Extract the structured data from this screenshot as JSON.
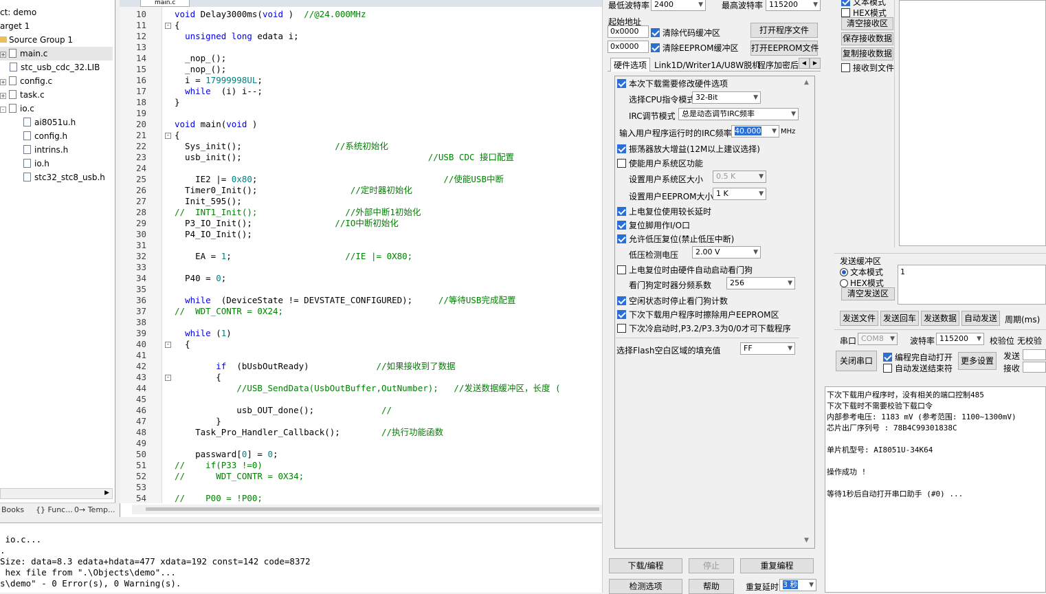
{
  "project": {
    "root": "ct: demo",
    "target": "arget 1",
    "group": "Source Group 1",
    "files": [
      "main.c",
      "stc_usb_cdc_32.LIB",
      "config.c",
      "task.c",
      "io.c"
    ],
    "headers": [
      "ai8051u.h",
      "config.h",
      "intrins.h",
      "io.h",
      "stc32_stc8_usb.h"
    ],
    "tabs": [
      "Books",
      "{} Func...",
      "0→ Temp..."
    ]
  },
  "editor": {
    "tab": "main.c",
    "lines": [
      {
        "n": "10",
        "fold": "",
        "code": [
          [
            "kw",
            "void"
          ],
          [
            "",
            "Delay3000ms("
          ],
          [
            "kw",
            "void"
          ],
          [
            "",
            ")  "
          ],
          [
            "cm",
            "//@24.000MHz"
          ]
        ]
      },
      {
        "n": "11",
        "fold": "-",
        "code": [
          [
            "",
            "{"
          ]
        ]
      },
      {
        "n": "12",
        "fold": "",
        "code": [
          [
            "",
            "  "
          ],
          [
            "kw",
            "unsigned long"
          ],
          [
            "",
            "edata i;"
          ]
        ]
      },
      {
        "n": "13",
        "fold": "",
        "code": []
      },
      {
        "n": "14",
        "fold": "",
        "code": [
          [
            "",
            "  _nop_();"
          ]
        ]
      },
      {
        "n": "15",
        "fold": "",
        "code": [
          [
            "",
            "  _nop_();"
          ]
        ]
      },
      {
        "n": "16",
        "fold": "",
        "code": [
          [
            "",
            "  i = "
          ],
          [
            "nm",
            "17999998UL"
          ],
          [
            "",
            ";"
          ]
        ]
      },
      {
        "n": "17",
        "fold": "",
        "code": [
          [
            "",
            "  "
          ],
          [
            "kw",
            "while"
          ],
          [
            "",
            "",
            " (i) i--;"
          ]
        ]
      },
      {
        "n": "18",
        "fold": "",
        "code": [
          [
            "",
            "}"
          ]
        ]
      },
      {
        "n": "19",
        "fold": "",
        "code": []
      },
      {
        "n": "20",
        "fold": "",
        "code": [
          [
            "kw",
            "void"
          ],
          [
            "",
            "main("
          ],
          [
            "kw",
            "void"
          ],
          [
            "",
            ")"
          ]
        ]
      },
      {
        "n": "21",
        "fold": "-",
        "code": [
          [
            "",
            "{"
          ]
        ]
      },
      {
        "n": "22",
        "fold": "",
        "code": [
          [
            "",
            "  Sys_init();                  "
          ],
          [
            "cm",
            "//系统初始化"
          ]
        ]
      },
      {
        "n": "23",
        "fold": "",
        "code": [
          [
            "",
            "  usb_init();                                    "
          ],
          [
            "cm",
            "//USB CDC 接口配置"
          ]
        ]
      },
      {
        "n": "24",
        "fold": "",
        "code": []
      },
      {
        "n": "25",
        "fold": "",
        "code": [
          [
            "",
            "    IE2 |= "
          ],
          [
            "nm",
            "0x80"
          ],
          [
            "",
            ";                                    "
          ],
          [
            "cm",
            "//使能USB中断"
          ]
        ]
      },
      {
        "n": "26",
        "fold": "",
        "code": [
          [
            "",
            "  Timer0_Init();                  "
          ],
          [
            "cm",
            "//定时器初始化"
          ]
        ]
      },
      {
        "n": "27",
        "fold": "",
        "code": [
          [
            "",
            "  Init_595();"
          ]
        ]
      },
      {
        "n": "28",
        "fold": "",
        "code": [
          [
            "cm",
            "//  INT1_Init();                 //外部中断1初始化"
          ]
        ]
      },
      {
        "n": "29",
        "fold": "",
        "code": [
          [
            "",
            "  P3_IO_Init();                "
          ],
          [
            "cm",
            "//IO中断初始化"
          ]
        ]
      },
      {
        "n": "30",
        "fold": "",
        "code": [
          [
            "",
            "  P4_IO_Init();"
          ]
        ]
      },
      {
        "n": "31",
        "fold": "",
        "code": []
      },
      {
        "n": "32",
        "fold": "",
        "code": [
          [
            "",
            "    EA = "
          ],
          [
            "nm",
            "1"
          ],
          [
            "",
            ";                      "
          ],
          [
            "cm",
            "//IE |= 0X80;"
          ]
        ]
      },
      {
        "n": "33",
        "fold": "",
        "code": []
      },
      {
        "n": "34",
        "fold": "",
        "code": [
          [
            "",
            "  P40 = "
          ],
          [
            "nm",
            "0"
          ],
          [
            "",
            ";"
          ]
        ]
      },
      {
        "n": "35",
        "fold": "",
        "code": []
      },
      {
        "n": "36",
        "fold": "",
        "code": [
          [
            "",
            "  "
          ],
          [
            "kw",
            "while"
          ],
          [
            "",
            "",
            " (DeviceState != DEVSTATE_CONFIGURED);     "
          ],
          [
            "cm",
            "//等待USB完成配置"
          ]
        ]
      },
      {
        "n": "37",
        "fold": "",
        "code": [
          [
            "cm",
            "//  WDT_CONTR = 0X24;"
          ]
        ]
      },
      {
        "n": "38",
        "fold": "",
        "code": []
      },
      {
        "n": "39",
        "fold": "",
        "code": [
          [
            "",
            "  "
          ],
          [
            "kw",
            "while"
          ],
          [
            "",
            "("
          ],
          [
            "nm",
            "1"
          ],
          [
            "",
            ")"
          ]
        ]
      },
      {
        "n": "40",
        "fold": "-",
        "code": [
          [
            "",
            "  {"
          ]
        ]
      },
      {
        "n": "41",
        "fold": "",
        "code": []
      },
      {
        "n": "42",
        "fold": "",
        "code": [
          [
            "",
            "        "
          ],
          [
            "kw",
            "if"
          ],
          [
            "",
            " (bUsbOutReady)             "
          ],
          [
            "cm",
            "//如果接收到了数据"
          ]
        ]
      },
      {
        "n": "43",
        "fold": "-",
        "code": [
          [
            "",
            "        {"
          ]
        ]
      },
      {
        "n": "44",
        "fold": "",
        "code": [
          [
            "",
            "            "
          ],
          [
            "cm",
            "//USB_SendData(UsbOutBuffer,OutNumber);   //发送数据缓冲区，长度 ("
          ]
        ]
      },
      {
        "n": "45",
        "fold": "",
        "code": []
      },
      {
        "n": "46",
        "fold": "",
        "code": [
          [
            "",
            "            usb_OUT_done();             "
          ],
          [
            "cm",
            "//"
          ]
        ]
      },
      {
        "n": "47",
        "fold": "",
        "code": [
          [
            "",
            "        }"
          ]
        ]
      },
      {
        "n": "48",
        "fold": "",
        "code": [
          [
            "",
            "    Task_Pro_Handler_Callback();        "
          ],
          [
            "cm",
            "//执行功能函数"
          ]
        ]
      },
      {
        "n": "49",
        "fold": "",
        "code": []
      },
      {
        "n": "50",
        "fold": "",
        "code": [
          [
            "",
            "    passward["
          ],
          [
            "nm",
            "0"
          ],
          [
            "",
            "] = "
          ],
          [
            "nm",
            "0"
          ],
          [
            "",
            ";"
          ]
        ]
      },
      {
        "n": "51",
        "fold": "",
        "code": [
          [
            "cm",
            "//    if(P33 !=0)"
          ]
        ]
      },
      {
        "n": "52",
        "fold": "",
        "code": [
          [
            "cm",
            "//      WDT_CONTR = 0X34;"
          ]
        ]
      },
      {
        "n": "53",
        "fold": "",
        "code": []
      },
      {
        "n": "54",
        "fold": "",
        "code": [
          [
            "cm",
            "//    P00 = !P00;"
          ]
        ]
      }
    ]
  },
  "build": {
    "lines": [
      " io.c...",
      ".",
      "Size: data=8.3 edata+hdata=477 xdata=192 const=142 code=8372",
      " hex file from \".\\Objects\\demo\"...",
      "s\\demo\" - 0 Error(s), 0 Warning(s)."
    ]
  },
  "isp": {
    "min_baud_label": "最低波特率",
    "min_baud": "2400",
    "max_baud_label": "最高波特率",
    "max_baud": "115200",
    "start_addr_label": "起始地址",
    "addr1": "0x0000",
    "addr2": "0x0000",
    "clear_code": "清除代码缓冲区",
    "clear_eeprom": "清除EEPROM缓冲区",
    "open_program": "打开程序文件",
    "open_eeprom": "打开EEPROM文件",
    "tabs": [
      "硬件选项",
      "Link1D/Writer1A/U8W脱机",
      "程序加密后"
    ],
    "opt_modify_hw": "本次下载需要修改硬件选项",
    "cpu_mode_label": "选择CPU指令模式",
    "cpu_mode": "32-Bit",
    "irc_mode_label": "IRC调节模式",
    "irc_mode": "总是动态调节IRC频率",
    "irc_freq_label": "输入用户程序运行时的IRC频率",
    "irc_freq": "40.000",
    "irc_unit": "MHz",
    "opt_osc_gain": "振荡器放大增益(12M以上建议选择)",
    "opt_sys_area": "使能用户系统区功能",
    "sys_area_size_label": "设置用户系统区大小",
    "sys_area_size": "0.5 K",
    "eeprom_size_label": "设置用户EEPROM大小",
    "eeprom_size": "1   K",
    "opt_long_delay": "上电复位使用较长延时",
    "opt_reset_io": "复位脚用作I/O口",
    "opt_lvr": "允许低压复位(禁止低压中断)",
    "lvd_label": "低压检测电压",
    "lvd": "2.00 V",
    "opt_wdt_auto": "上电复位时由硬件自动启动看门狗",
    "wdt_div_label": "看门狗定时器分频系数",
    "wdt_div": "256",
    "opt_idle_wdt": "空闲状态时停止看门狗计数",
    "opt_erase_eeprom": "下次下载用户程序时擦除用户EEPROM区",
    "opt_cold_boot": "下次冷启动时,P3.2/P3.3为0/0才可下载程序",
    "flash_fill_label": "选择Flash空白区域的填充值",
    "flash_fill": "FF",
    "btn_download": "下载/编程",
    "btn_stop": "停止",
    "btn_reprogram": "重复编程",
    "btn_detect": "检测选项",
    "btn_help": "帮助",
    "repeat_delay_label": "重复延时",
    "repeat_delay": "3 秒"
  },
  "serial": {
    "rcv_text_mode": "文本模式",
    "rcv_hex_mode": "HEX模式",
    "clear_rcv": "清空接收区",
    "save_rcv": "保存接收数据",
    "copy_rcv": "复制接收数据",
    "rcv_to_file": "接收到文件",
    "send_buffer_label": "发送缓冲区",
    "snd_text_mode": "文本模式",
    "snd_hex_mode": "HEX模式",
    "clear_snd": "清空发送区",
    "send_content": "1",
    "btn_send_file": "发送文件",
    "btn_send_cr": "发送回车",
    "btn_send_data": "发送数据",
    "btn_auto_send": "自动发送",
    "period_label": "周期(ms)",
    "port_label": "串口",
    "port": "COM8",
    "baud_label": "波特率",
    "baud": "115200",
    "parity_label": "校验位",
    "parity": "无校验",
    "btn_close_port": "关闭串口",
    "auto_open": "编程完自动打开",
    "auto_send_end": "自动发送结束符",
    "btn_more": "更多设置",
    "send_label": "发送",
    "recv_label": "接收"
  },
  "log": {
    "lines": [
      "  下次下载用户程序时，没有相关的端口控制485",
      "  下次下载时不需要校验下载口令",
      "  内部参考电压: 1183 mV (参考范围: 1100~1300mV)",
      "芯片出厂序列号 : 78B4C99301838C",
      "",
      "  单片机型号: AI8051U-34K64",
      "",
      "操作成功 !",
      "",
      "等待1秒后自动打开串口助手 (#0) ..."
    ]
  }
}
